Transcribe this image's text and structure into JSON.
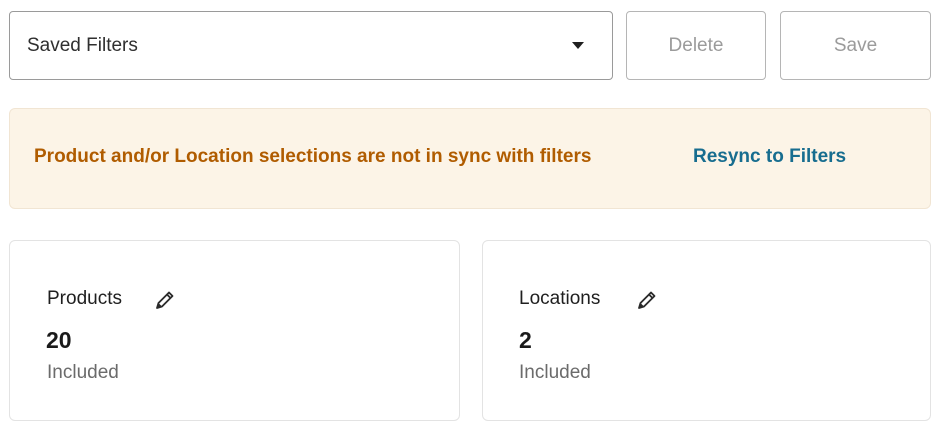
{
  "saved_filters": {
    "label": "Saved Filters"
  },
  "buttons": {
    "delete": "Delete",
    "save": "Save"
  },
  "banner": {
    "message": "Product and/or Location selections are not in sync with filters",
    "link": "Resync to Filters"
  },
  "cards": {
    "products": {
      "title": "Products",
      "count": "20",
      "status": "Included"
    },
    "locations": {
      "title": "Locations",
      "count": "2",
      "status": "Included"
    }
  },
  "icons": {
    "dropdown": "chevron-down-icon",
    "edit": "pencil-icon"
  },
  "colors": {
    "warning_text": "#b05c00",
    "link_text": "#176d8f",
    "banner_bg": "#fcf4e7"
  }
}
